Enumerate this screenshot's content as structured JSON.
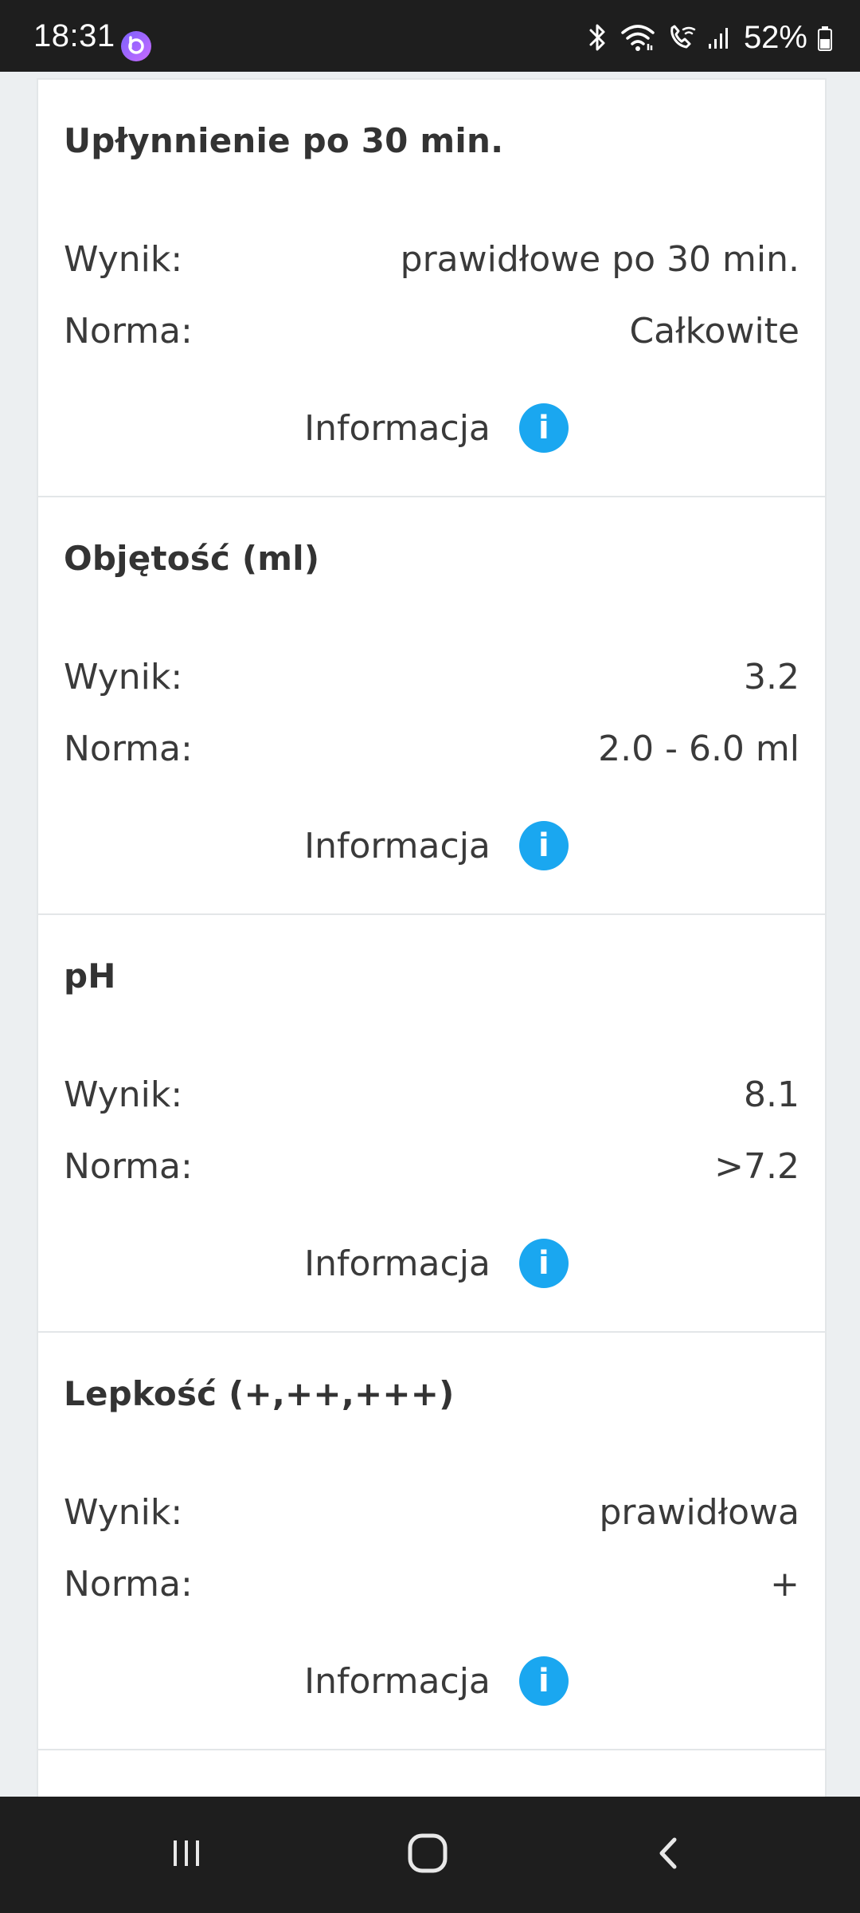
{
  "status_bar": {
    "time": "18:31",
    "battery": "52%",
    "icons": [
      "bluetooth-icon",
      "wifi-icon",
      "wifi-calling-icon",
      "signal-icon",
      "battery-icon"
    ]
  },
  "cards": [
    {
      "title": "Upłynnienie po 30 min.",
      "result_label": "Wynik:",
      "result_value": "prawidłowe po 30 min.",
      "norm_label": "Norma:",
      "norm_value": "Całkowite",
      "info_label": "Informacja",
      "info_icon": "i"
    },
    {
      "title": "Objętość (ml)",
      "result_label": "Wynik:",
      "result_value": "3.2",
      "norm_label": "Norma:",
      "norm_value": "2.0 - 6.0 ml",
      "info_label": "Informacja",
      "info_icon": "i"
    },
    {
      "title": "pH",
      "result_label": "Wynik:",
      "result_value": "8.1",
      "norm_label": "Norma:",
      "norm_value": ">7.2",
      "info_label": "Informacja",
      "info_icon": "i"
    },
    {
      "title": "Lepkość (+,++,+++)",
      "result_label": "Wynik:",
      "result_value": "prawidłowa",
      "norm_label": "Norma:",
      "norm_value": "+",
      "info_label": "Informacja",
      "info_icon": "i"
    }
  ],
  "nav_bar": {
    "buttons": [
      "recent-apps-icon",
      "home-icon",
      "back-icon"
    ]
  },
  "colors": {
    "info_icon": "#1aa7f0",
    "bars": "#1e1e1e"
  }
}
